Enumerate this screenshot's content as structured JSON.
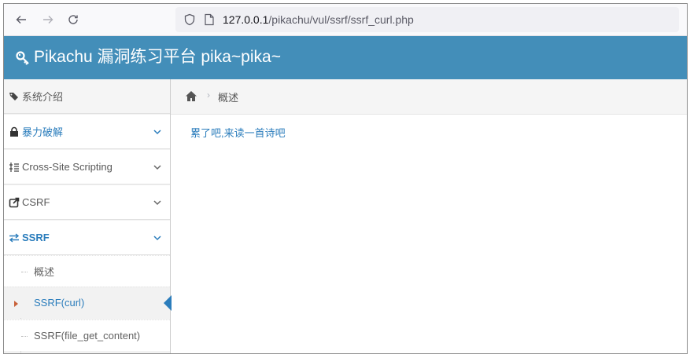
{
  "browser": {
    "url_host": "127.0.0.1",
    "url_path": "/pikachu/vul/ssrf/ssrf_curl.php"
  },
  "header": {
    "title": "Pikachu 漏洞练习平台 pika~pika~"
  },
  "sidebar": {
    "items": [
      {
        "label": "系统介绍",
        "icon": "tags-icon"
      },
      {
        "label": "暴力破解",
        "icon": "lock-icon"
      },
      {
        "label": "Cross-Site Scripting",
        "icon": "list-icon"
      },
      {
        "label": "CSRF",
        "icon": "share-icon"
      },
      {
        "label": "SSRF",
        "icon": "exchange-icon"
      }
    ],
    "ssrf_submenu": [
      {
        "label": "概述"
      },
      {
        "label": "SSRF(curl)"
      },
      {
        "label": "SSRF(file_get_content)"
      }
    ]
  },
  "breadcrumb": {
    "current": "概述"
  },
  "content": {
    "link_text": "累了吧,来读一首诗吧"
  },
  "colors": {
    "header_bg": "#438eb9",
    "accent": "#2b7dbc"
  }
}
